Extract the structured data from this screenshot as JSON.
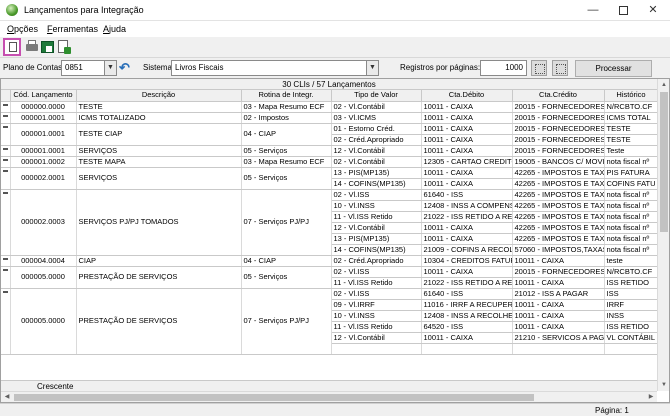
{
  "window": {
    "title": "Lançamentos para Integração",
    "minimize": "—",
    "close": "✕"
  },
  "menu": [
    "Opções",
    "Ferramentas",
    "Ajuda"
  ],
  "filters": {
    "plano_label": "Plano de Contas",
    "plano_value": "0851",
    "sistema_label": "Sistema",
    "sistema_value": "Livros Fiscais",
    "registros_label": "Registros por páginas:",
    "registros_value": "1000",
    "processar_label": "Processar"
  },
  "grid": {
    "summary": "30 CLIs / 57 Lançamentos",
    "columns": [
      "Cód. Lançamento",
      "Descrição",
      "Rotina de Integr.",
      "Tipo de Valor",
      "Cta.Débito",
      "Cta.Crédito",
      "Histórico"
    ],
    "rows": [
      {
        "marker": true,
        "code": "000000.0000",
        "desc": "TESTE",
        "rotina": "03 - Mapa Resumo ECF",
        "tipo": "02 - Vl.Contábil",
        "deb": "10011 - CAIXA",
        "cred": "20015 - FORNECEDORES",
        "hist": "N/RCBTO.CF"
      },
      {
        "marker": true,
        "code": "000001.0001",
        "desc": "ICMS TOTALIZADO",
        "rotina": "02 - Impostos",
        "tipo": "03 - Vl.ICMS",
        "deb": "10011 - CAIXA",
        "cred": "20015 - FORNECEDORES",
        "hist": "ICMS TOTAL"
      },
      {
        "marker": true,
        "code": "000001.0001",
        "desc": "TESTE CIAP",
        "rotina": "04 - CIAP",
        "tipo": "01 - Estorno Créd.",
        "deb": "10011 - CAIXA",
        "cred": "20015 - FORNECEDORES",
        "hist": "TESTE",
        "span": 2
      },
      {
        "cont": true,
        "tipo": "02 - Créd.Apropriado",
        "deb": "10011 - CAIXA",
        "cred": "20015 - FORNECEDORES",
        "hist": "TESTE"
      },
      {
        "marker": true,
        "code": "000001.0001",
        "desc": "SERVIÇOS",
        "rotina": "05 - Serviços",
        "tipo": "12 - Vl.Contábil",
        "deb": "10011 - CAIXA",
        "cred": "20015 - FORNECEDORES",
        "hist": "Teste"
      },
      {
        "marker": true,
        "code": "000001.0002",
        "desc": "TESTE MAPA",
        "rotina": "03 - Mapa Resumo ECF",
        "tipo": "02 - Vl.Contábil",
        "deb": "12305 - CARTAO CREDITO",
        "cred": "19005 - BANCOS C/ MOVIM",
        "hist": "nota fiscal nº"
      },
      {
        "marker": true,
        "code": "000002.0001",
        "desc": "SERVIÇOS",
        "rotina": "05 - Serviços",
        "tipo": "13 - PIS(MP135)",
        "deb": "10011 - CAIXA",
        "cred": "42265 - IMPOSTOS E TAXA",
        "hist": "PIS FATURA",
        "span": 2
      },
      {
        "cont": true,
        "tipo": "14 - COFINS(MP135)",
        "deb": "10011 - CAIXA",
        "cred": "42265 - IMPOSTOS E TAXA",
        "hist": "COFINS FATU"
      },
      {
        "marker": true,
        "code": "000002.0003",
        "desc": "SERVIÇOS PJ/PJ TOMADOS",
        "rotina": "07 - Serviços PJ/PJ",
        "tipo": "02 - Vl.ISS",
        "deb": "61640 - ISS",
        "cred": "42265 - IMPOSTOS E TAXA",
        "hist": "nota fiscal nº",
        "span": 6
      },
      {
        "cont": true,
        "tipo": "10 - Vl.INSS",
        "deb": "12408 - INSS A COMPENSA",
        "cred": "42265 - IMPOSTOS E TAXA",
        "hist": "nota fiscal nº"
      },
      {
        "cont": true,
        "tipo": "11 - Vl.ISS Retido",
        "deb": "21022 - ISS RETIDO A REC",
        "cred": "42265 - IMPOSTOS E TAXA",
        "hist": "nota fiscal nº"
      },
      {
        "cont": true,
        "tipo": "12 - Vl.Contábil",
        "deb": "10011 - CAIXA",
        "cred": "42265 - IMPOSTOS E TAXA",
        "hist": "nota fiscal nº"
      },
      {
        "cont": true,
        "tipo": "13 - PIS(MP135)",
        "deb": "10011 - CAIXA",
        "cred": "42265 - IMPOSTOS E TAXA",
        "hist": "nota fiscal nº"
      },
      {
        "cont": true,
        "tipo": "14 - COFINS(MP135)",
        "deb": "21009 - COFINS A RECOLH",
        "cred": "57060 - IMPOSTOS,TAXAS",
        "hist": "nota fiscal nº"
      },
      {
        "marker": true,
        "code": "000004.0004",
        "desc": "CIAP",
        "rotina": "04 - CIAP",
        "tipo": "02 - Créd.Apropriado",
        "deb": "10304 - CREDITOS FATURA",
        "cred": "10011 - CAIXA",
        "hist": "teste"
      },
      {
        "marker": true,
        "code": "000005.0000",
        "desc": "PRESTAÇÃO DE SERVIÇOS",
        "rotina": "05 - Serviços",
        "tipo": "02 - Vl.ISS",
        "deb": "10011 - CAIXA",
        "cred": "20015 - FORNECEDORES",
        "hist": "N/RCBTO.CF",
        "span": 2
      },
      {
        "cont": true,
        "tipo": "11 - Vl.ISS Retido",
        "deb": "21022 - ISS RETIDO A REC",
        "cred": "10011 - CAIXA",
        "hist": "ISS RETIDO"
      },
      {
        "marker": true,
        "code": "000005.0000",
        "desc": "PRESTAÇÃO DE SERVIÇOS",
        "rotina": "07 - Serviços PJ/PJ",
        "tipo": "02 - Vl.ISS",
        "deb": "61640 - ISS",
        "cred": "21012 - ISS A PAGAR",
        "hist": "ISS",
        "span": 6
      },
      {
        "cont": true,
        "tipo": "09 - Vl.IRRF",
        "deb": "11016 - IRRF A RECUPERA",
        "cred": "10011 - CAIXA",
        "hist": "IRRF"
      },
      {
        "cont": true,
        "tipo": "10 - Vl.INSS",
        "deb": "12408 - INSS A RECOLHER",
        "cred": "10011 - CAIXA",
        "hist": "INSS"
      },
      {
        "cont": true,
        "tipo": "11 - Vl.ISS Retido",
        "deb": "64520 - ISS",
        "cred": "10011 - CAIXA",
        "hist": "ISS RETIDO"
      },
      {
        "cont": true,
        "tipo": "12 - Vl.Contábil",
        "deb": "10011 - CAIXA",
        "cred": "21210 - SERVICOS A PAGA",
        "hist": "VL CONTÁBIL"
      },
      {
        "cont": true,
        "tipo": "",
        "deb": "",
        "cred": "",
        "hist": ""
      }
    ],
    "sort_label": "Crescente"
  },
  "status": {
    "page": "Página: 1"
  },
  "colors": {
    "accent_border": "#c64fb0",
    "undo_icon": "#2a6fb8"
  }
}
